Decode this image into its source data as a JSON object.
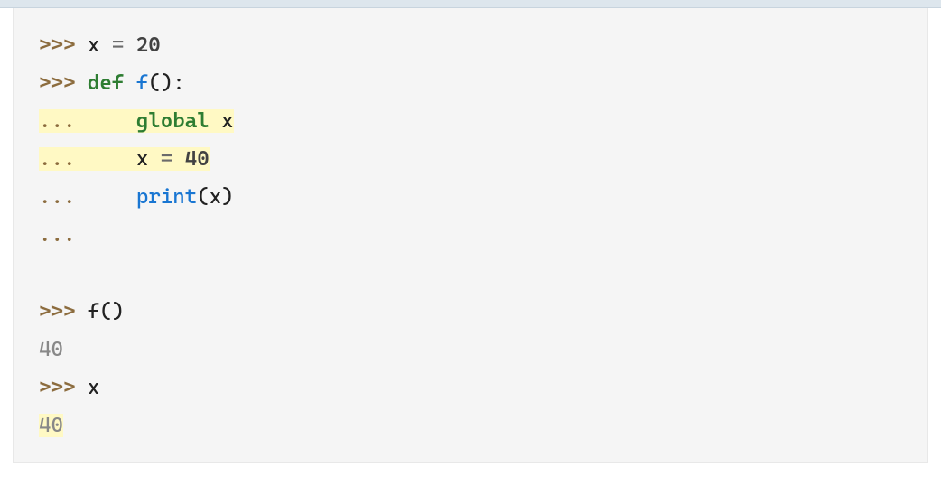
{
  "code": {
    "prompt_primary": ">>> ",
    "prompt_continuation": "... ",
    "indent": "    ",
    "line1_var": "x",
    "line1_eq": " = ",
    "line1_val": "20",
    "line2_def": "def",
    "line2_name": " f",
    "line2_parens": "()",
    "line2_colon": ":",
    "line3_global": "global",
    "line3_var": " x",
    "line4_var": "x",
    "line4_eq": " = ",
    "line4_val": "40",
    "line5_print": "print",
    "line5_open": "(",
    "line5_arg": "x",
    "line5_close": ")",
    "line8_call": "f",
    "line8_parens": "()",
    "line9_out": "40",
    "line10_var": "x",
    "line11_out": "40"
  }
}
